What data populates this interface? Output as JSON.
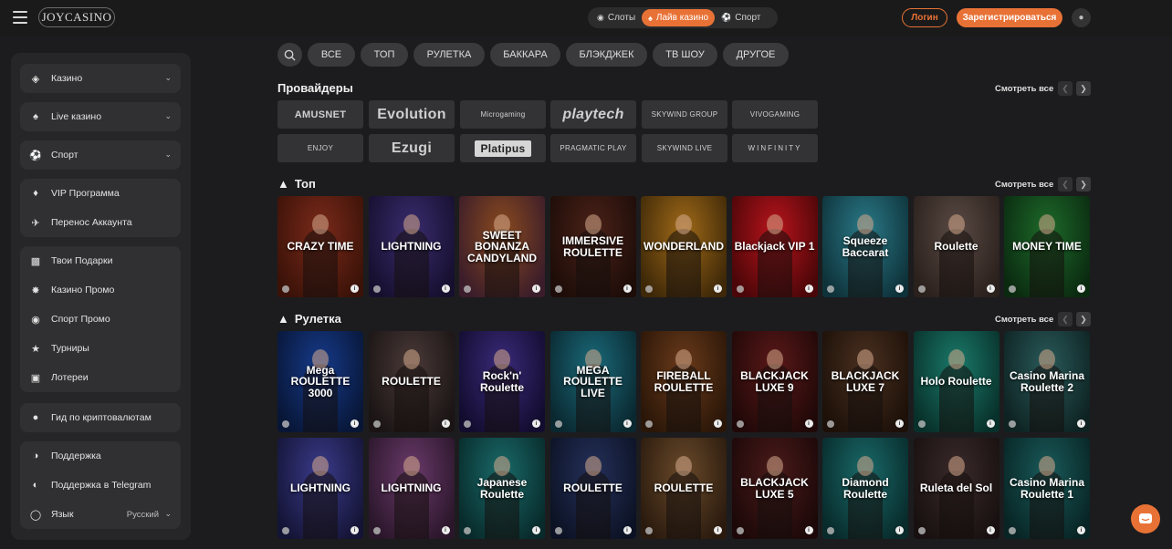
{
  "header": {
    "logo": "JOYCASINO",
    "tabs": [
      {
        "label": "Слоты",
        "icon": "slots-icon",
        "active": false
      },
      {
        "label": "Лайв казино",
        "icon": "live-casino-icon",
        "active": true
      },
      {
        "label": "Спорт",
        "icon": "sport-icon",
        "active": false
      }
    ],
    "login_label": "Логин",
    "register_label": "Зарегистрироваться"
  },
  "sidebar": {
    "items": [
      {
        "label": "Казино",
        "icon": "casino-icon"
      },
      {
        "label": "Live казино",
        "icon": "live-casino-icon"
      },
      {
        "label": "Спорт",
        "icon": "sport-icon"
      },
      {
        "label": "VIP Программа",
        "icon": "vip-icon"
      },
      {
        "label": "Перенос Аккаунта",
        "icon": "plane-icon"
      },
      {
        "label": "Твои Подарки",
        "icon": "gift-icon"
      },
      {
        "label": "Казино Промо",
        "icon": "promo-icon"
      },
      {
        "label": "Спорт Промо",
        "icon": "sport-promo-icon"
      },
      {
        "label": "Турниры",
        "icon": "trophy-icon"
      },
      {
        "label": "Лотереи",
        "icon": "lottery-icon"
      },
      {
        "label": "Гид по криптовалютам",
        "icon": "bitcoin-icon"
      },
      {
        "label": "Поддержка",
        "icon": "support-icon"
      },
      {
        "label": "Поддержка в Telegram",
        "icon": "telegram-icon"
      },
      {
        "label": "Язык",
        "icon": "globe-icon"
      }
    ],
    "language_value": "Русский"
  },
  "filters": [
    "ВСЕ",
    "ТОП",
    "РУЛЕТКА",
    "БАККАРА",
    "БЛЭКДЖЕК",
    "ТВ ШОУ",
    "ДРУГОЕ"
  ],
  "see_all": "Смотреть все",
  "providers": {
    "title": "Провайдеры",
    "items": [
      "AMUSNET",
      "Evolution",
      "Microgaming",
      "playtech",
      "SKYWIND GROUP",
      "VIVOGAMING",
      "ENJOY",
      "Ezugi",
      "Platipus",
      "PRAGMATIC PLAY",
      "SKYWIND LIVE",
      "WINFINITY"
    ]
  },
  "top": {
    "title": "Топ",
    "games": [
      "CRAZY TIME",
      "LIGHTNING",
      "SWEET BONANZA CANDYLAND",
      "IMMERSIVE ROULETTE",
      "WONDERLAND",
      "Blackjack VIP 1",
      "Squeeze Baccarat",
      "Roulette",
      "MONEY TIME"
    ]
  },
  "roulette": {
    "title": "Рулетка",
    "row1": [
      "Mega ROULETTE 3000",
      "ROULETTE",
      "Rock'n' Roulette",
      "MEGA ROULETTE LIVE",
      "FIREBALL ROULETTE",
      "BLACKJACK LUXE 9",
      "BLACKJACK LUXE 7",
      "Holo Roulette",
      "Casino Marina Roulette 2"
    ],
    "row2": [
      "LIGHTNING",
      "LIGHTNING",
      "Japanese Roulette",
      "ROULETTE",
      "ROULETTE",
      "BLACKJACK LUXE 5",
      "Diamond Roulette",
      "Ruleta del Sol",
      "Casino Marina Roulette 1"
    ]
  },
  "colors": {
    "accent": "#e87236",
    "background": "#1c1c1e",
    "panel": "#262628"
  }
}
